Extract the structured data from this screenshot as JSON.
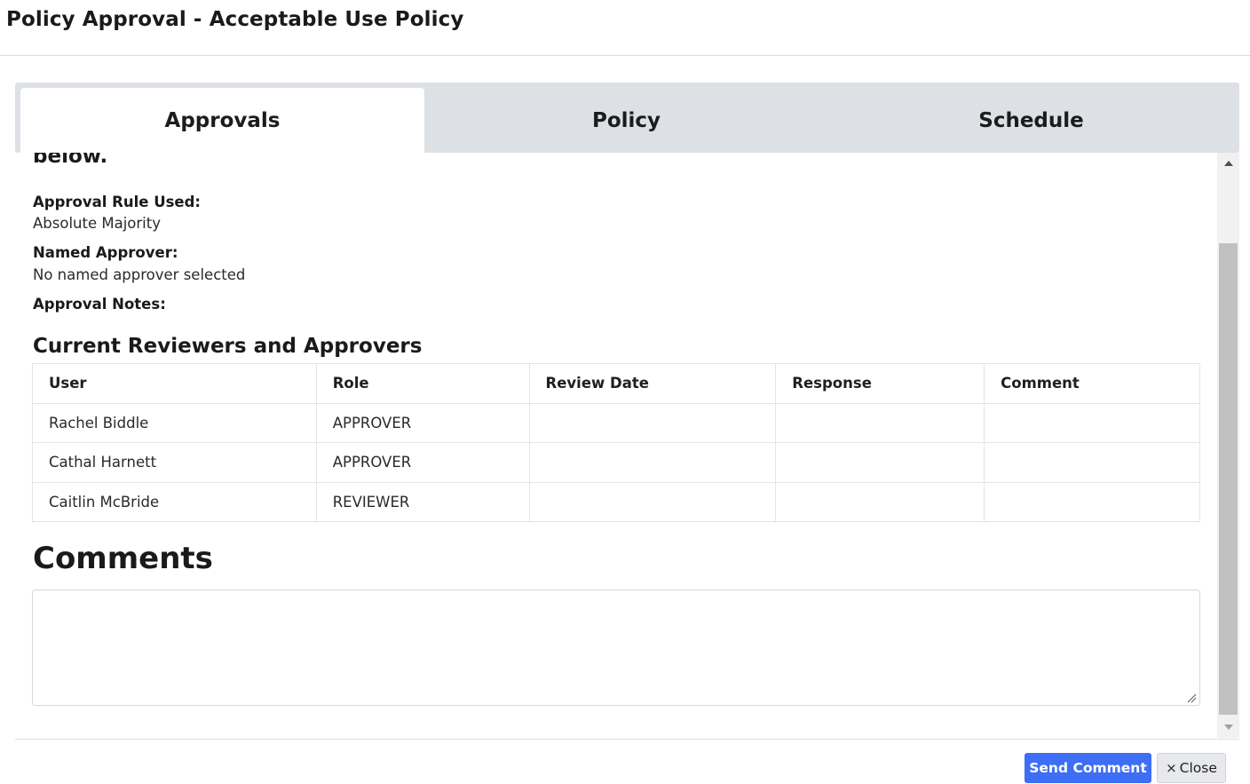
{
  "header": {
    "title": "Policy Approval - Acceptable Use Policy"
  },
  "tabs": [
    {
      "label": "Approvals",
      "active": true
    },
    {
      "label": "Policy",
      "active": false
    },
    {
      "label": "Schedule",
      "active": false
    }
  ],
  "approvals": {
    "cut_heading": "below.",
    "rule_label": "Approval Rule Used:",
    "rule_value": "Absolute Majority",
    "named_label": "Named Approver:",
    "named_value": "No named approver selected",
    "notes_label": "Approval Notes:",
    "reviewers_title": "Current Reviewers and Approvers",
    "columns": [
      "User",
      "Role",
      "Review Date",
      "Response",
      "Comment"
    ],
    "rows": [
      {
        "user": "Rachel Biddle",
        "role": "APPROVER",
        "review_date": "",
        "response": "",
        "comment": ""
      },
      {
        "user": "Cathal Harnett",
        "role": "APPROVER",
        "review_date": "",
        "response": "",
        "comment": ""
      },
      {
        "user": "Caitlin McBride",
        "role": "REVIEWER",
        "review_date": "",
        "response": "",
        "comment": ""
      }
    ],
    "comments_title": "Comments",
    "comment_value": ""
  },
  "footer": {
    "send_label": "Send Comment",
    "close_icon": "×",
    "close_label": "Close"
  },
  "colors": {
    "primary": "#3d6ef5",
    "tab_bar": "#dde0e5",
    "scroll_thumb": "#c1c1c1"
  }
}
